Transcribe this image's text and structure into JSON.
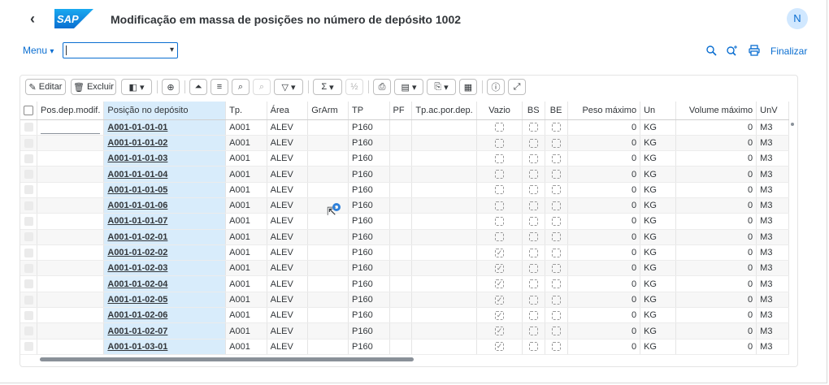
{
  "shell": {
    "logo_text": "SAP",
    "title": "Modificação em massa de posições no número de depósito 1002",
    "user_initial": "N"
  },
  "menubar": {
    "menu_label": "Menu",
    "command_value": "",
    "exit_label": "Finalizar"
  },
  "toolbar": {
    "edit_label": "Editar",
    "delete_label": "Excluir"
  },
  "table": {
    "columns": [
      "Pos.dep.modif.",
      "Posição no depósito",
      "Tp.",
      "Área",
      "GrArm",
      "TP",
      "PF",
      "Tp.ac.por.dep.",
      "Vazio",
      "BS",
      "BE",
      "Peso máximo",
      "Un",
      "Volume máximo",
      "UnV"
    ],
    "rows": [
      {
        "bin": "A001-01-01-01",
        "tp": "A001",
        "area": "ALEV",
        "grarm": "",
        "tptype": "P160",
        "pf": "",
        "tpac": "",
        "empty": false,
        "bs": false,
        "be": false,
        "weight": "0",
        "un": "KG",
        "volume": "0",
        "unv": "M3"
      },
      {
        "bin": "A001-01-01-02",
        "tp": "A001",
        "area": "ALEV",
        "grarm": "",
        "tptype": "P160",
        "pf": "",
        "tpac": "",
        "empty": false,
        "bs": false,
        "be": false,
        "weight": "0",
        "un": "KG",
        "volume": "0",
        "unv": "M3"
      },
      {
        "bin": "A001-01-01-03",
        "tp": "A001",
        "area": "ALEV",
        "grarm": "",
        "tptype": "P160",
        "pf": "",
        "tpac": "",
        "empty": false,
        "bs": false,
        "be": false,
        "weight": "0",
        "un": "KG",
        "volume": "0",
        "unv": "M3"
      },
      {
        "bin": "A001-01-01-04",
        "tp": "A001",
        "area": "ALEV",
        "grarm": "",
        "tptype": "P160",
        "pf": "",
        "tpac": "",
        "empty": false,
        "bs": false,
        "be": false,
        "weight": "0",
        "un": "KG",
        "volume": "0",
        "unv": "M3"
      },
      {
        "bin": "A001-01-01-05",
        "tp": "A001",
        "area": "ALEV",
        "grarm": "",
        "tptype": "P160",
        "pf": "",
        "tpac": "",
        "empty": false,
        "bs": false,
        "be": false,
        "weight": "0",
        "un": "KG",
        "volume": "0",
        "unv": "M3"
      },
      {
        "bin": "A001-01-01-06",
        "tp": "A001",
        "area": "ALEV",
        "grarm": "",
        "tptype": "P160",
        "pf": "",
        "tpac": "",
        "empty": false,
        "bs": false,
        "be": false,
        "weight": "0",
        "un": "KG",
        "volume": "0",
        "unv": "M3"
      },
      {
        "bin": "A001-01-01-07",
        "tp": "A001",
        "area": "ALEV",
        "grarm": "",
        "tptype": "P160",
        "pf": "",
        "tpac": "",
        "empty": false,
        "bs": false,
        "be": false,
        "weight": "0",
        "un": "KG",
        "volume": "0",
        "unv": "M3"
      },
      {
        "bin": "A001-01-02-01",
        "tp": "A001",
        "area": "ALEV",
        "grarm": "",
        "tptype": "P160",
        "pf": "",
        "tpac": "",
        "empty": false,
        "bs": false,
        "be": false,
        "weight": "0",
        "un": "KG",
        "volume": "0",
        "unv": "M3"
      },
      {
        "bin": "A001-01-02-02",
        "tp": "A001",
        "area": "ALEV",
        "grarm": "",
        "tptype": "P160",
        "pf": "",
        "tpac": "",
        "empty": true,
        "bs": false,
        "be": false,
        "weight": "0",
        "un": "KG",
        "volume": "0",
        "unv": "M3"
      },
      {
        "bin": "A001-01-02-03",
        "tp": "A001",
        "area": "ALEV",
        "grarm": "",
        "tptype": "P160",
        "pf": "",
        "tpac": "",
        "empty": true,
        "bs": false,
        "be": false,
        "weight": "0",
        "un": "KG",
        "volume": "0",
        "unv": "M3"
      },
      {
        "bin": "A001-01-02-04",
        "tp": "A001",
        "area": "ALEV",
        "grarm": "",
        "tptype": "P160",
        "pf": "",
        "tpac": "",
        "empty": true,
        "bs": false,
        "be": false,
        "weight": "0",
        "un": "KG",
        "volume": "0",
        "unv": "M3"
      },
      {
        "bin": "A001-01-02-05",
        "tp": "A001",
        "area": "ALEV",
        "grarm": "",
        "tptype": "P160",
        "pf": "",
        "tpac": "",
        "empty": true,
        "bs": false,
        "be": false,
        "weight": "0",
        "un": "KG",
        "volume": "0",
        "unv": "M3"
      },
      {
        "bin": "A001-01-02-06",
        "tp": "A001",
        "area": "ALEV",
        "grarm": "",
        "tptype": "P160",
        "pf": "",
        "tpac": "",
        "empty": true,
        "bs": false,
        "be": false,
        "weight": "0",
        "un": "KG",
        "volume": "0",
        "unv": "M3"
      },
      {
        "bin": "A001-01-02-07",
        "tp": "A001",
        "area": "ALEV",
        "grarm": "",
        "tptype": "P160",
        "pf": "",
        "tpac": "",
        "empty": true,
        "bs": false,
        "be": false,
        "weight": "0",
        "un": "KG",
        "volume": "0",
        "unv": "M3"
      },
      {
        "bin": "A001-01-03-01",
        "tp": "A001",
        "area": "ALEV",
        "grarm": "",
        "tptype": "P160",
        "pf": "",
        "tpac": "",
        "empty": true,
        "bs": false,
        "be": false,
        "weight": "0",
        "un": "KG",
        "volume": "0",
        "unv": "M3"
      }
    ]
  },
  "colors": {
    "accent": "#0a6ed1",
    "key_column": "#d8ecfb",
    "text": "#32363a"
  }
}
